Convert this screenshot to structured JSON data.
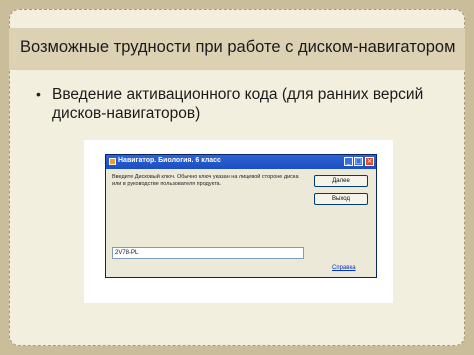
{
  "slide": {
    "title": "Возможные трудности при работе с диском-навигатором",
    "bullet_marker": "•",
    "bullet": "Введение активационного кода (для ранних версий дисков-навигаторов)"
  },
  "dialog": {
    "title": "Навигатор. Биология. 6 класс",
    "message": "Введите Дисковый ключ. Обычно ключ указан на лицевой стороне диска или в руководстве пользователя продукта.",
    "next_button": "Далее",
    "exit_button": "Выход",
    "code_value": "2V78-PL",
    "help_link": "Справка",
    "window_buttons": {
      "minimize": "_",
      "maximize": "□",
      "close": "×"
    }
  },
  "colors": {
    "background": "#c9bd9a",
    "slide": "#f3efde",
    "title_band": "#dcd2b3",
    "titlebar": "#1a4fc2"
  }
}
